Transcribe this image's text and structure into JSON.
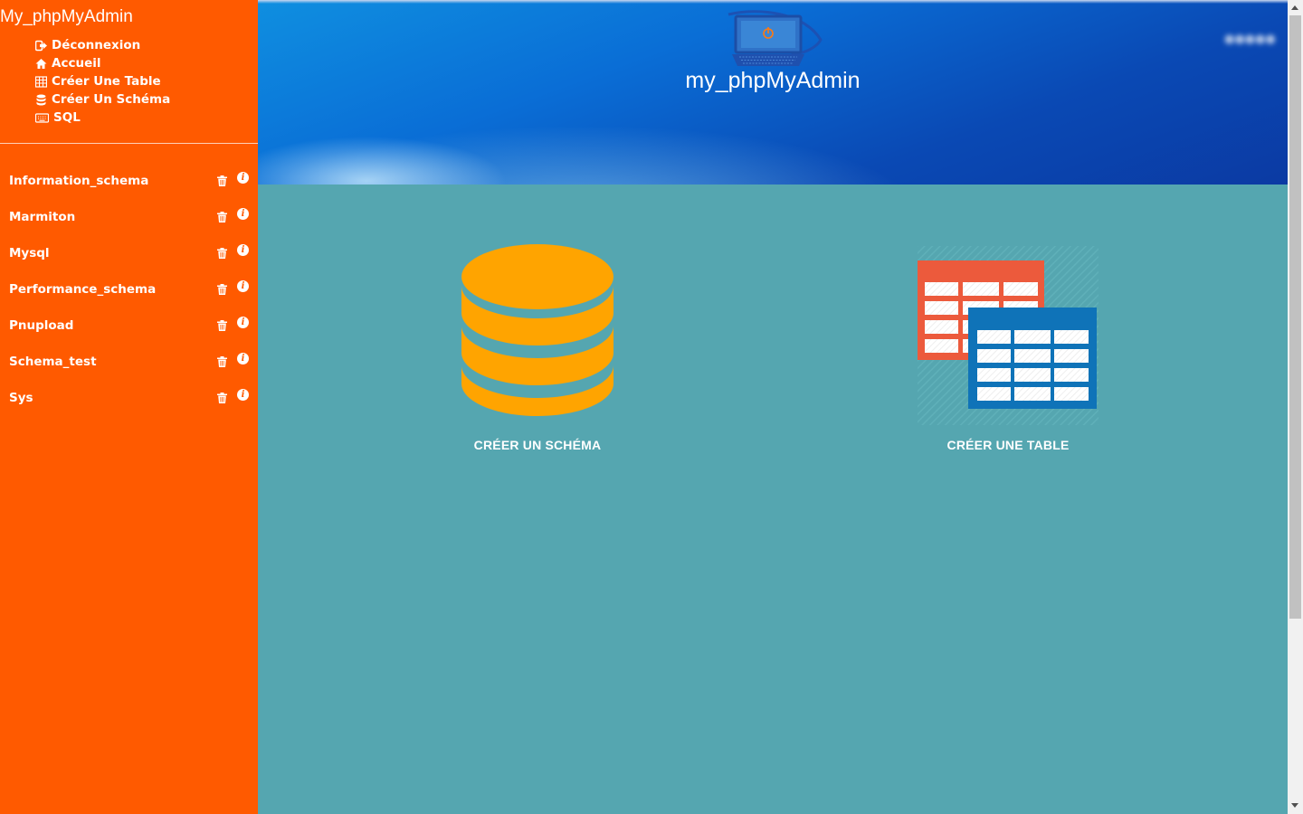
{
  "sidebar": {
    "brand": "My_phpMyAdmin",
    "nav": [
      {
        "label": "Déconnexion",
        "icon": "sign-out-icon"
      },
      {
        "label": "Accueil",
        "icon": "home-icon"
      },
      {
        "label": "Créer Une Table",
        "icon": "table-icon"
      },
      {
        "label": "Créer Un Schéma",
        "icon": "database-icon"
      },
      {
        "label": "SQL",
        "icon": "keyboard-icon"
      }
    ],
    "databases": [
      {
        "name": "Information_schema"
      },
      {
        "name": "Marmiton"
      },
      {
        "name": "Mysql"
      },
      {
        "name": "Performance_schema"
      },
      {
        "name": "Pnupload"
      },
      {
        "name": "Schema_test"
      },
      {
        "name": "Sys"
      }
    ],
    "row_icons": {
      "delete": "trash-icon",
      "info": "info-icon"
    },
    "info_glyph": "i"
  },
  "header": {
    "title": "my_phpMyAdmin",
    "logo": "power-laptop-logo"
  },
  "main": {
    "create_schema": {
      "label": "CRÉER UN SCHÉMA",
      "icon": "database-icon"
    },
    "create_table": {
      "label": "CRÉER UNE TABLE",
      "icon": "tables-icon"
    }
  },
  "colors": {
    "sidebar": "#ff5a00",
    "main_bg": "#55a6b0",
    "database_icon": "#ffa400",
    "table_red": "#ec5a3c",
    "table_blue": "#0f73b8"
  }
}
